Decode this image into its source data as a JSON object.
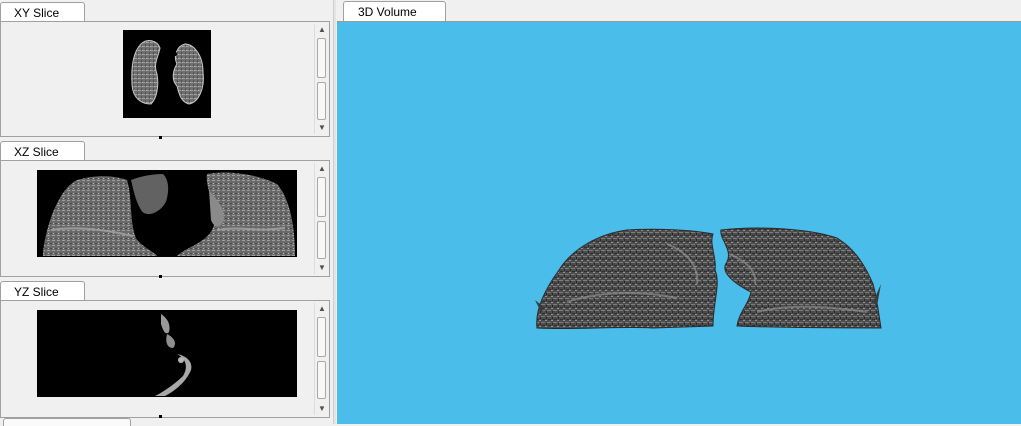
{
  "panels": {
    "xy": {
      "tab_label": "XY Slice"
    },
    "xz": {
      "tab_label": "XZ Slice"
    },
    "yz": {
      "tab_label": "YZ Slice"
    }
  },
  "volume": {
    "tab_label": "3D Volume",
    "background_color": "#4bbdea"
  },
  "scrollbar": {
    "up_arrow_icon": "triangle-up",
    "down_arrow_icon": "triangle-down"
  }
}
